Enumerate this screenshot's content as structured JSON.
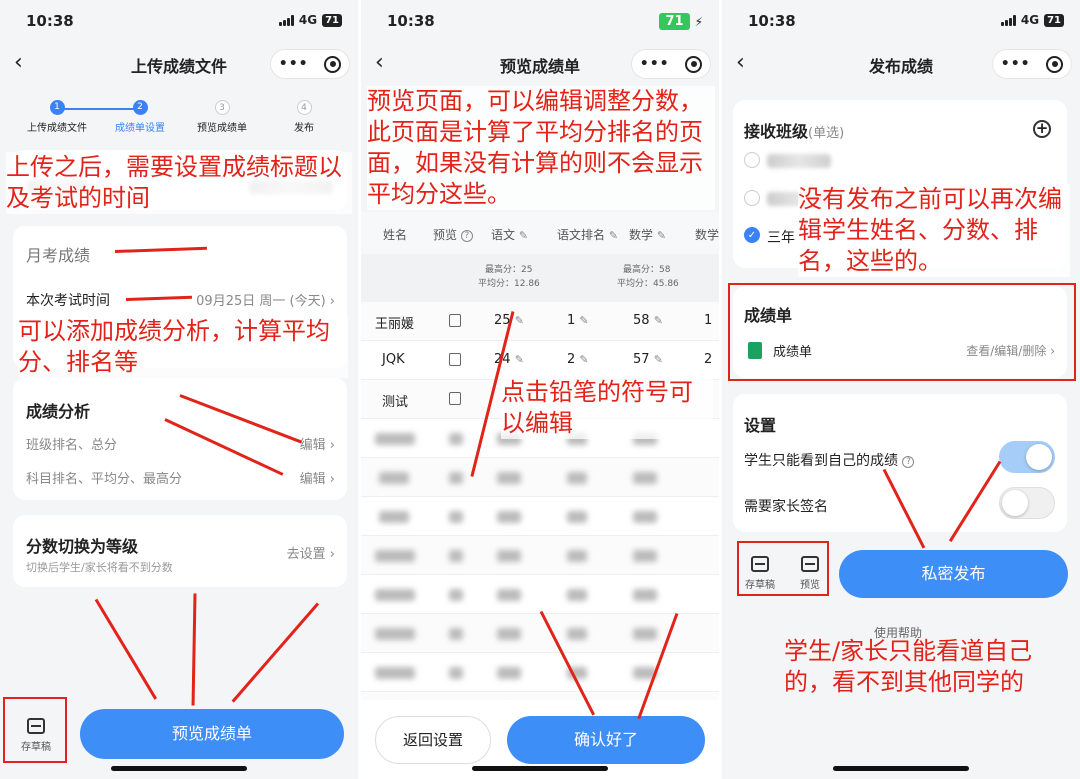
{
  "status": {
    "time": "10:38",
    "network": "4G",
    "battery": "71"
  },
  "phone1": {
    "nav_title": "上传成绩文件",
    "steps": [
      {
        "num": "1",
        "label": "上传成绩文件"
      },
      {
        "num": "2",
        "label": "成绩单设置"
      },
      {
        "num": "3",
        "label": "预览成绩单"
      },
      {
        "num": "4",
        "label": "发布"
      }
    ],
    "score_title": "月考成绩",
    "exam_time_label": "本次考试时间",
    "exam_time_value": "09月25日 周一 (今天)",
    "analysis_title": "成绩分析",
    "analysis_rows": [
      {
        "label": "班级排名、总分",
        "action": "编辑"
      },
      {
        "label": "科目排名、平均分、最高分",
        "action": "编辑"
      }
    ],
    "grade_title": "分数切换为等级",
    "grade_hint": "切换后学生/家长将看不到分数",
    "grade_action": "去设置",
    "draft_label": "存草稿",
    "preview_button": "预览成绩单",
    "notes": {
      "top": "上传之后，需要设置成绩标题以及考试的时间",
      "middle": "可以添加成绩分析，计算平均分、排名等"
    }
  },
  "phone2": {
    "nav_title": "预览成绩单",
    "columns": [
      "姓名",
      "预览",
      "语文",
      "语文排名",
      "数学",
      "数学"
    ],
    "stats": {
      "chinese": {
        "max": "最高分：25",
        "avg": "平均分：12.86"
      },
      "math": {
        "max": "最高分：58",
        "avg": "平均分：45.86"
      }
    },
    "rows": [
      {
        "name": "王丽媛",
        "chinese": "25",
        "rank": "1",
        "math": "58",
        "rank2": "1"
      },
      {
        "name": "JQK",
        "chinese": "24",
        "rank": "2",
        "math": "57",
        "rank2": "2"
      },
      {
        "name": "测试",
        "chinese": "",
        "rank": "",
        "math": "",
        "rank2": ""
      }
    ],
    "back_button": "返回设置",
    "confirm_button": "确认好了",
    "notes": {
      "top": "预览页面，可以编辑调整分数，此页面是计算了平均分排名的页面，如果没有计算的则不会显示平均分这些。",
      "pencil": "点击铅笔的符号可以编辑"
    }
  },
  "phone3": {
    "nav_title": "发布成绩",
    "class_title": "接收班级",
    "class_hint": "(单选)",
    "class_selected": "三年",
    "sheet_title": "成绩单",
    "sheet_name": "成绩单",
    "sheet_actions": "查看/编辑/删除",
    "settings_title": "设置",
    "setting_own_only": "学生只能看到自己的成绩",
    "setting_own_only_on": true,
    "setting_parent_sign": "需要家长签名",
    "setting_parent_sign_on": false,
    "draft_label": "存草稿",
    "preview_label": "预览",
    "publish_button": "私密发布",
    "help_link": "使用帮助",
    "notes": {
      "top": "没有发布之前可以再次编辑学生姓名、分数、排名，这些的。",
      "bottom": "学生/家长只能看道自己的，看不到其他同学的"
    }
  }
}
